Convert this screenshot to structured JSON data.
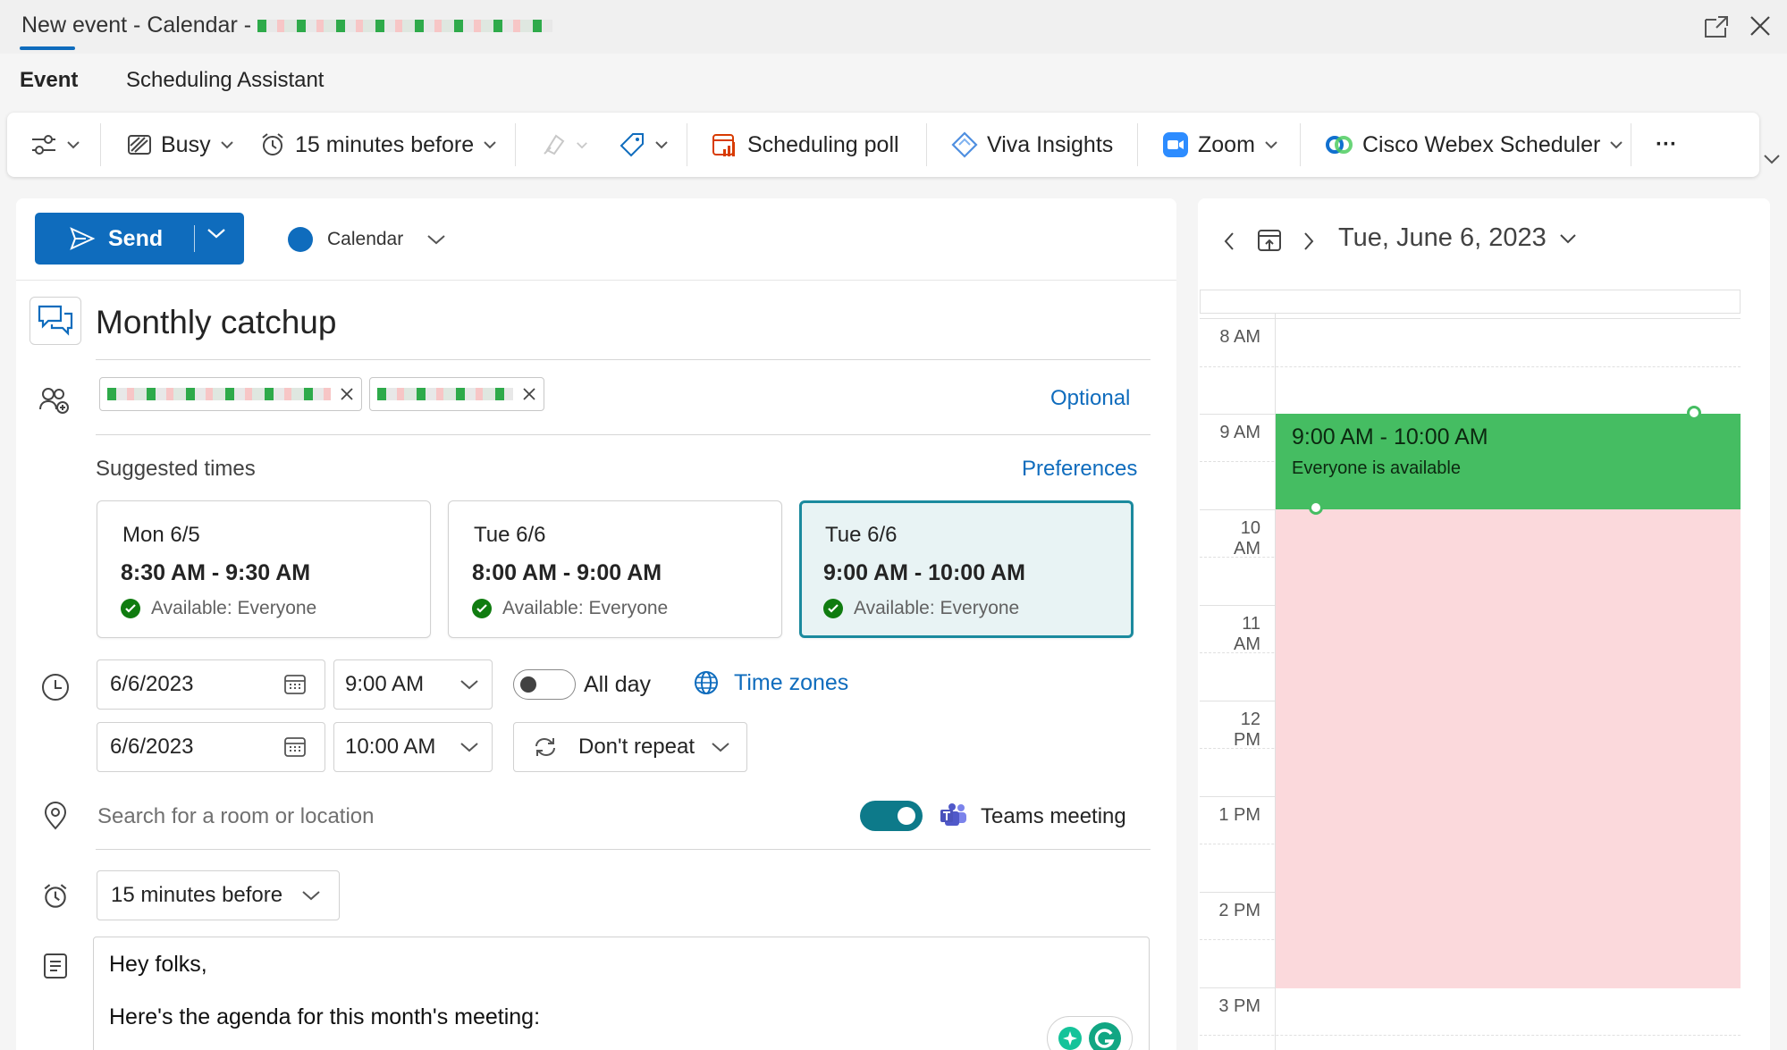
{
  "window": {
    "title": "New event - Calendar - "
  },
  "tabs": [
    {
      "label": "Event"
    },
    {
      "label": "Scheduling Assistant"
    }
  ],
  "toolbar": {
    "busy": "Busy",
    "reminder": "15 minutes before",
    "scheduling_poll": "Scheduling poll",
    "viva_insights": "Viva Insights",
    "zoom": "Zoom",
    "webex": "Cisco Webex Scheduler",
    "more": "···"
  },
  "form": {
    "send_label": "Send",
    "calendar_label": "Calendar",
    "title": "Monthly catchup",
    "optional_link": "Optional",
    "suggested_label": "Suggested times",
    "preferences_link": "Preferences",
    "suggestions": [
      {
        "day": "Mon 6/5",
        "time": "8:30 AM - 9:30 AM",
        "availability": "Available: Everyone"
      },
      {
        "day": "Tue 6/6",
        "time": "8:00 AM - 9:00 AM",
        "availability": "Available: Everyone"
      },
      {
        "day": "Tue 6/6",
        "time": "9:00 AM - 10:00 AM",
        "availability": "Available: Everyone"
      }
    ],
    "start_date": "6/6/2023",
    "start_time": "9:00 AM",
    "end_date": "6/6/2023",
    "end_time": "10:00 AM",
    "all_day_label": "All day",
    "time_zones_link": "Time zones",
    "repeat": "Don't repeat",
    "location_placeholder": "Search for a room or location",
    "teams_label": "Teams meeting",
    "reminder": "15 minutes before",
    "body_line1": "Hey folks,",
    "body_line2": "Here's the agenda for this month's meeting:"
  },
  "calendar_panel": {
    "date": "Tue, June 6, 2023",
    "hours": [
      "8 AM",
      "9 AM",
      "10 AM",
      "11 AM",
      "12 PM",
      "1 PM",
      "2 PM",
      "3 PM"
    ],
    "event_time": "9:00 AM - 10:00 AM",
    "event_status": "Everyone is available"
  },
  "colors": {
    "accent": "#0f6cbd",
    "event_green": "#45bd62",
    "busy_pink": "#fbd9dc",
    "selected_card": "#1b8a9e"
  }
}
